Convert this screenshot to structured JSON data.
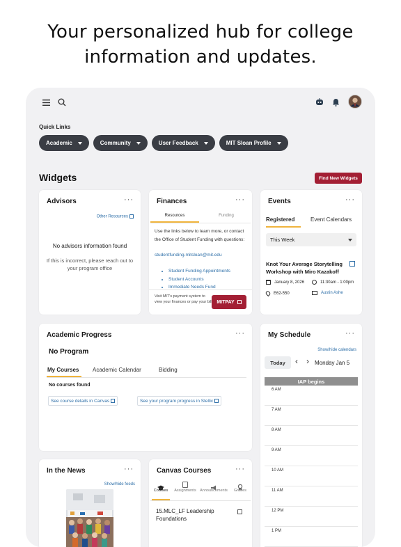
{
  "headline": {
    "line1": "Your personalized hub for college",
    "line2": "information and updates."
  },
  "topbar": {
    "menu_icon": "hamburger-icon",
    "search_icon": "search-icon",
    "bot_icon": "chatbot-icon",
    "bell_icon": "bell-icon"
  },
  "quick_links": {
    "title": "Quick Links",
    "items": [
      {
        "label": "Academic"
      },
      {
        "label": "Community"
      },
      {
        "label": "User Feedback"
      },
      {
        "label": "MIT Sloan Profile"
      }
    ]
  },
  "widgets": {
    "title": "Widgets",
    "find_button": "Find New Widgets"
  },
  "advisors": {
    "title": "Advisors",
    "more": "···",
    "other_resources": "Other Resources",
    "empty_title": "No advisors information found",
    "empty_body": "If this is incorrect, please reach out to your program office"
  },
  "finances": {
    "title": "Finances",
    "more": "···",
    "tabs": [
      "Resources",
      "Funding"
    ],
    "intro": "Use the links below to learn more, or contact the Office of Student Funding with questions:",
    "email": "studentfunding.mitsloan@mit.edu",
    "links": [
      "Student Funding Appointments",
      "Student Accounts",
      "Immediate Needs Fund"
    ],
    "footer_text": "Visit MIT's payment system to view your finances or pay your bill",
    "mitpay_button": "MITPAY"
  },
  "events": {
    "title": "Events",
    "more": "···",
    "tabs": [
      "Registered",
      "Event Calendars"
    ],
    "filter_value": "This Week",
    "event_title": "Knot Your Average Storytelling Workshop with Miro Kazakoff",
    "date": "January 8, 2026",
    "time": "11:30am - 1:00pm",
    "location": "E62-550",
    "contact": "Austin Ashe"
  },
  "academic_progress": {
    "title": "Academic Progress",
    "more": "···",
    "program": "No Program",
    "tabs": [
      "My Courses",
      "Academic Calendar",
      "Bidding"
    ],
    "empty": "No courses found",
    "link1": "See course details in Canvas",
    "link2": "See your program progress in Stellic"
  },
  "schedule": {
    "title": "My Schedule",
    "more": "···",
    "toggle": "Show/hide calendars",
    "today_button": "Today",
    "prev": "‹",
    "next": "›",
    "date": "Monday Jan 5",
    "banner": "IAP begins",
    "hours": [
      "6 AM",
      "7 AM",
      "8 AM",
      "9 AM",
      "10 AM",
      "11 AM",
      "12 PM",
      "1 PM"
    ]
  },
  "news": {
    "title": "In the News",
    "more": "···",
    "toggle": "Show/hide feeds"
  },
  "canvas": {
    "title": "Canvas Courses",
    "more": "···",
    "tabs": [
      "Courses",
      "Assignments",
      "Announcements",
      "Grades"
    ],
    "course": "15.MLC_LF Leadership Foundations"
  }
}
